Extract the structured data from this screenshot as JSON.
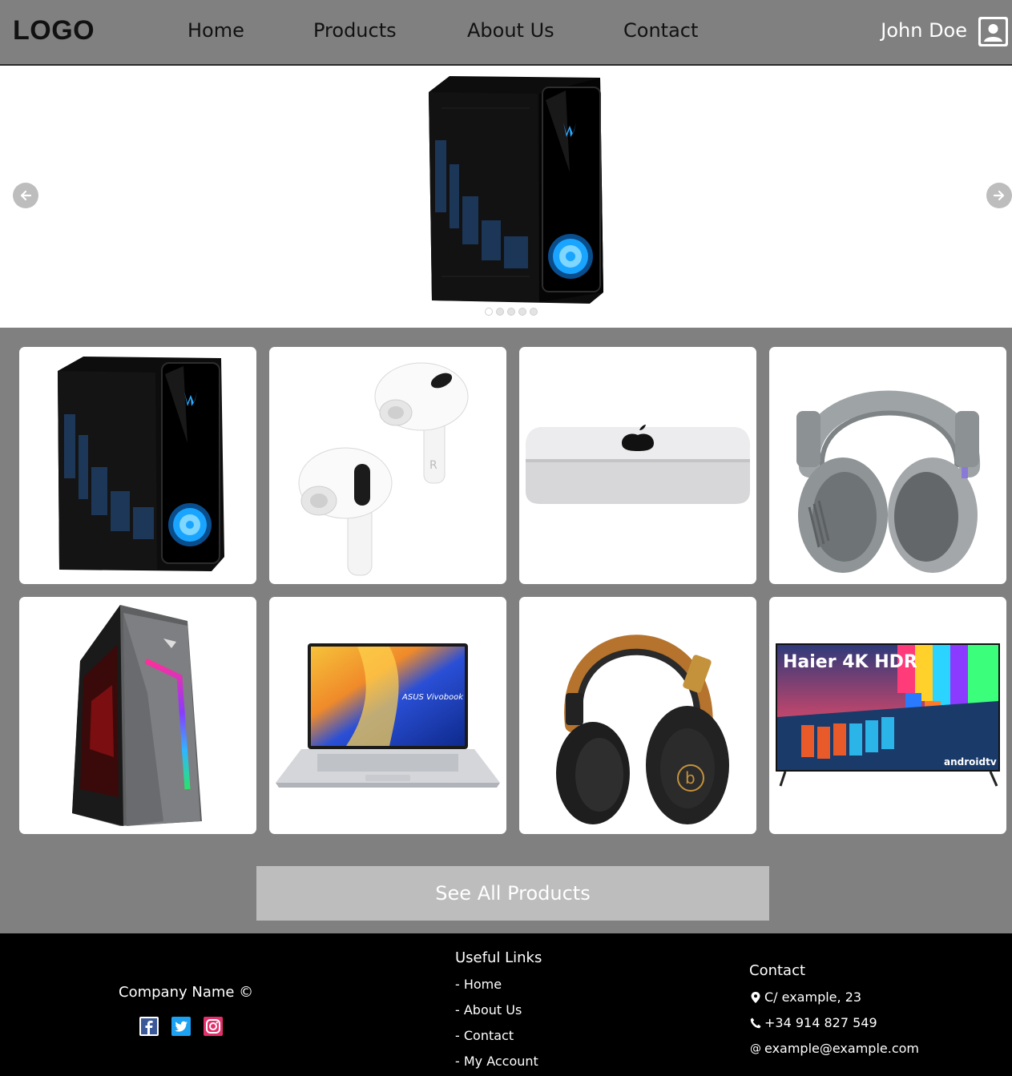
{
  "header": {
    "logo": "LOGO",
    "nav": [
      "Home",
      "Products",
      "About Us",
      "Contact"
    ],
    "user_name": "John Doe"
  },
  "carousel": {
    "slide_count": 5,
    "active_slide": 1
  },
  "products": {
    "items": [
      {
        "icon": "gaming-pc-tower"
      },
      {
        "icon": "wireless-earbuds"
      },
      {
        "icon": "mini-desktop"
      },
      {
        "icon": "gray-headset"
      },
      {
        "icon": "rgb-gaming-tower"
      },
      {
        "icon": "laptop",
        "screen_text": "ASUS Vivobook"
      },
      {
        "icon": "black-headphones"
      },
      {
        "icon": "television",
        "screen_title": "Haier 4K HDR",
        "screen_badge": "androidtv"
      }
    ],
    "see_all_label": "See All Products"
  },
  "footer": {
    "company": "Company Name ©",
    "useful_links_title": "Useful Links",
    "links": [
      "- Home",
      "- About Us",
      "- Contact",
      "- My Account"
    ],
    "contact_title": "Contact",
    "address": "C/ example, 23",
    "phone": "+34 914 827 549",
    "email": "example@example.com"
  },
  "colors": {
    "header_bg": "#808080",
    "footer_bg": "#000000",
    "button_bg": "#bdbdbd",
    "facebook": "#3b5998",
    "twitter": "#1da1f2",
    "instagram": "#e1306c"
  }
}
